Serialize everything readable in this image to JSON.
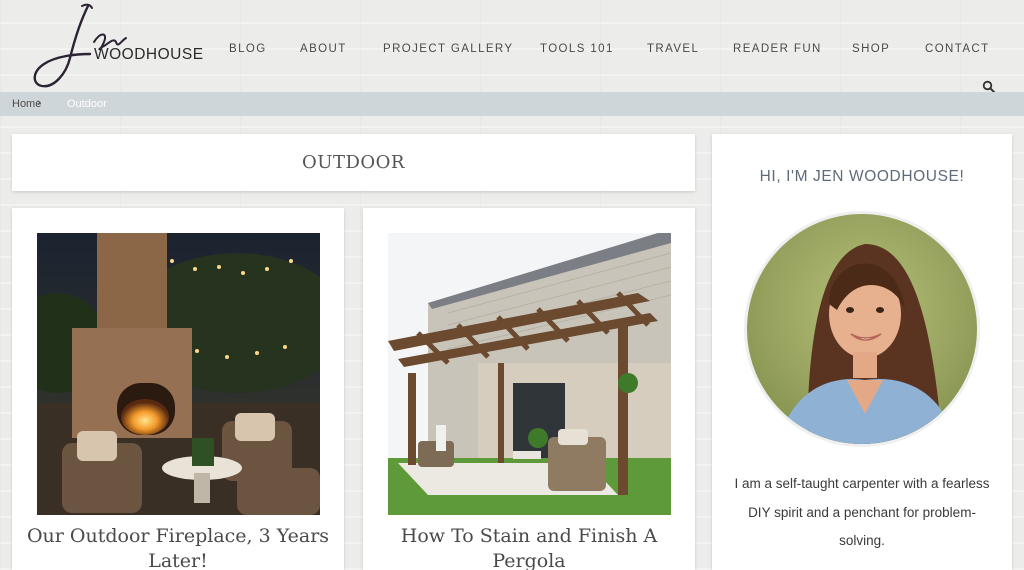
{
  "brand": {
    "script_name": "Jen",
    "wordmark": "WOODHOUSE"
  },
  "nav": {
    "items": [
      "BLOG",
      "ABOUT",
      "PROJECT GALLERY",
      "TOOLS 101",
      "TRAVEL",
      "READER FUN",
      "SHOP",
      "CONTACT"
    ],
    "search_icon": "search-icon"
  },
  "breadcrumb": {
    "home": "Home",
    "separator": "›",
    "current": "Outdoor"
  },
  "category": {
    "title": "OUTDOOR"
  },
  "posts": [
    {
      "title": "Our Outdoor Fireplace, 3 Years Later!"
    },
    {
      "title": "How To Stain and Finish A Pergola"
    }
  ],
  "sidebar": {
    "heading": "HI, I'M JEN WOODHOUSE!",
    "bio": "I am a self-taught carpenter with a fearless DIY spirit and a penchant for problem-solving."
  },
  "colors": {
    "breadcrumb_bar": "#cfd6d9",
    "nav_text": "#4a4a4a",
    "sidebar_heading": "#5f6b78"
  }
}
